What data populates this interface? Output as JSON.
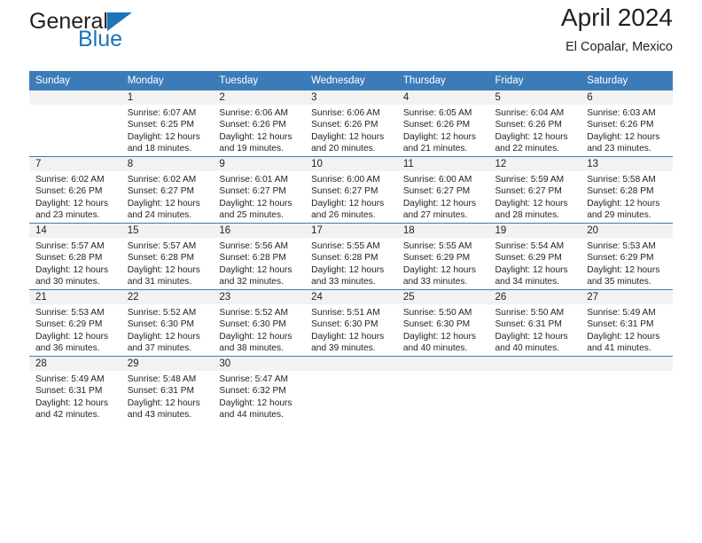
{
  "brand": {
    "name_top": "General",
    "name_bottom": "Blue",
    "accent_color": "#1b75bb"
  },
  "header": {
    "title": "April 2024",
    "subtitle": "El Copalar, Mexico"
  },
  "theme": {
    "header_row_bg": "#3b7cb8",
    "daynum_band_bg": "#f2f2f2",
    "text_color": "#231f20"
  },
  "weekday_headers": [
    "Sunday",
    "Monday",
    "Tuesday",
    "Wednesday",
    "Thursday",
    "Friday",
    "Saturday"
  ],
  "labels": {
    "sunrise_prefix": "Sunrise:",
    "sunset_prefix": "Sunset:",
    "daylight_prefix": "Daylight:"
  },
  "weeks": [
    [
      {
        "day": "",
        "sunrise": "",
        "sunset": "",
        "daylight_line1": "",
        "daylight_line2": ""
      },
      {
        "day": "1",
        "sunrise": "Sunrise: 6:07 AM",
        "sunset": "Sunset: 6:25 PM",
        "daylight_line1": "Daylight: 12 hours",
        "daylight_line2": "and 18 minutes."
      },
      {
        "day": "2",
        "sunrise": "Sunrise: 6:06 AM",
        "sunset": "Sunset: 6:26 PM",
        "daylight_line1": "Daylight: 12 hours",
        "daylight_line2": "and 19 minutes."
      },
      {
        "day": "3",
        "sunrise": "Sunrise: 6:06 AM",
        "sunset": "Sunset: 6:26 PM",
        "daylight_line1": "Daylight: 12 hours",
        "daylight_line2": "and 20 minutes."
      },
      {
        "day": "4",
        "sunrise": "Sunrise: 6:05 AM",
        "sunset": "Sunset: 6:26 PM",
        "daylight_line1": "Daylight: 12 hours",
        "daylight_line2": "and 21 minutes."
      },
      {
        "day": "5",
        "sunrise": "Sunrise: 6:04 AM",
        "sunset": "Sunset: 6:26 PM",
        "daylight_line1": "Daylight: 12 hours",
        "daylight_line2": "and 22 minutes."
      },
      {
        "day": "6",
        "sunrise": "Sunrise: 6:03 AM",
        "sunset": "Sunset: 6:26 PM",
        "daylight_line1": "Daylight: 12 hours",
        "daylight_line2": "and 23 minutes."
      }
    ],
    [
      {
        "day": "7",
        "sunrise": "Sunrise: 6:02 AM",
        "sunset": "Sunset: 6:26 PM",
        "daylight_line1": "Daylight: 12 hours",
        "daylight_line2": "and 23 minutes."
      },
      {
        "day": "8",
        "sunrise": "Sunrise: 6:02 AM",
        "sunset": "Sunset: 6:27 PM",
        "daylight_line1": "Daylight: 12 hours",
        "daylight_line2": "and 24 minutes."
      },
      {
        "day": "9",
        "sunrise": "Sunrise: 6:01 AM",
        "sunset": "Sunset: 6:27 PM",
        "daylight_line1": "Daylight: 12 hours",
        "daylight_line2": "and 25 minutes."
      },
      {
        "day": "10",
        "sunrise": "Sunrise: 6:00 AM",
        "sunset": "Sunset: 6:27 PM",
        "daylight_line1": "Daylight: 12 hours",
        "daylight_line2": "and 26 minutes."
      },
      {
        "day": "11",
        "sunrise": "Sunrise: 6:00 AM",
        "sunset": "Sunset: 6:27 PM",
        "daylight_line1": "Daylight: 12 hours",
        "daylight_line2": "and 27 minutes."
      },
      {
        "day": "12",
        "sunrise": "Sunrise: 5:59 AM",
        "sunset": "Sunset: 6:27 PM",
        "daylight_line1": "Daylight: 12 hours",
        "daylight_line2": "and 28 minutes."
      },
      {
        "day": "13",
        "sunrise": "Sunrise: 5:58 AM",
        "sunset": "Sunset: 6:28 PM",
        "daylight_line1": "Daylight: 12 hours",
        "daylight_line2": "and 29 minutes."
      }
    ],
    [
      {
        "day": "14",
        "sunrise": "Sunrise: 5:57 AM",
        "sunset": "Sunset: 6:28 PM",
        "daylight_line1": "Daylight: 12 hours",
        "daylight_line2": "and 30 minutes."
      },
      {
        "day": "15",
        "sunrise": "Sunrise: 5:57 AM",
        "sunset": "Sunset: 6:28 PM",
        "daylight_line1": "Daylight: 12 hours",
        "daylight_line2": "and 31 minutes."
      },
      {
        "day": "16",
        "sunrise": "Sunrise: 5:56 AM",
        "sunset": "Sunset: 6:28 PM",
        "daylight_line1": "Daylight: 12 hours",
        "daylight_line2": "and 32 minutes."
      },
      {
        "day": "17",
        "sunrise": "Sunrise: 5:55 AM",
        "sunset": "Sunset: 6:28 PM",
        "daylight_line1": "Daylight: 12 hours",
        "daylight_line2": "and 33 minutes."
      },
      {
        "day": "18",
        "sunrise": "Sunrise: 5:55 AM",
        "sunset": "Sunset: 6:29 PM",
        "daylight_line1": "Daylight: 12 hours",
        "daylight_line2": "and 33 minutes."
      },
      {
        "day": "19",
        "sunrise": "Sunrise: 5:54 AM",
        "sunset": "Sunset: 6:29 PM",
        "daylight_line1": "Daylight: 12 hours",
        "daylight_line2": "and 34 minutes."
      },
      {
        "day": "20",
        "sunrise": "Sunrise: 5:53 AM",
        "sunset": "Sunset: 6:29 PM",
        "daylight_line1": "Daylight: 12 hours",
        "daylight_line2": "and 35 minutes."
      }
    ],
    [
      {
        "day": "21",
        "sunrise": "Sunrise: 5:53 AM",
        "sunset": "Sunset: 6:29 PM",
        "daylight_line1": "Daylight: 12 hours",
        "daylight_line2": "and 36 minutes."
      },
      {
        "day": "22",
        "sunrise": "Sunrise: 5:52 AM",
        "sunset": "Sunset: 6:30 PM",
        "daylight_line1": "Daylight: 12 hours",
        "daylight_line2": "and 37 minutes."
      },
      {
        "day": "23",
        "sunrise": "Sunrise: 5:52 AM",
        "sunset": "Sunset: 6:30 PM",
        "daylight_line1": "Daylight: 12 hours",
        "daylight_line2": "and 38 minutes."
      },
      {
        "day": "24",
        "sunrise": "Sunrise: 5:51 AM",
        "sunset": "Sunset: 6:30 PM",
        "daylight_line1": "Daylight: 12 hours",
        "daylight_line2": "and 39 minutes."
      },
      {
        "day": "25",
        "sunrise": "Sunrise: 5:50 AM",
        "sunset": "Sunset: 6:30 PM",
        "daylight_line1": "Daylight: 12 hours",
        "daylight_line2": "and 40 minutes."
      },
      {
        "day": "26",
        "sunrise": "Sunrise: 5:50 AM",
        "sunset": "Sunset: 6:31 PM",
        "daylight_line1": "Daylight: 12 hours",
        "daylight_line2": "and 40 minutes."
      },
      {
        "day": "27",
        "sunrise": "Sunrise: 5:49 AM",
        "sunset": "Sunset: 6:31 PM",
        "daylight_line1": "Daylight: 12 hours",
        "daylight_line2": "and 41 minutes."
      }
    ],
    [
      {
        "day": "28",
        "sunrise": "Sunrise: 5:49 AM",
        "sunset": "Sunset: 6:31 PM",
        "daylight_line1": "Daylight: 12 hours",
        "daylight_line2": "and 42 minutes."
      },
      {
        "day": "29",
        "sunrise": "Sunrise: 5:48 AM",
        "sunset": "Sunset: 6:31 PM",
        "daylight_line1": "Daylight: 12 hours",
        "daylight_line2": "and 43 minutes."
      },
      {
        "day": "30",
        "sunrise": "Sunrise: 5:47 AM",
        "sunset": "Sunset: 6:32 PM",
        "daylight_line1": "Daylight: 12 hours",
        "daylight_line2": "and 44 minutes."
      },
      {
        "day": "",
        "sunrise": "",
        "sunset": "",
        "daylight_line1": "",
        "daylight_line2": ""
      },
      {
        "day": "",
        "sunrise": "",
        "sunset": "",
        "daylight_line1": "",
        "daylight_line2": ""
      },
      {
        "day": "",
        "sunrise": "",
        "sunset": "",
        "daylight_line1": "",
        "daylight_line2": ""
      },
      {
        "day": "",
        "sunrise": "",
        "sunset": "",
        "daylight_line1": "",
        "daylight_line2": ""
      }
    ]
  ]
}
